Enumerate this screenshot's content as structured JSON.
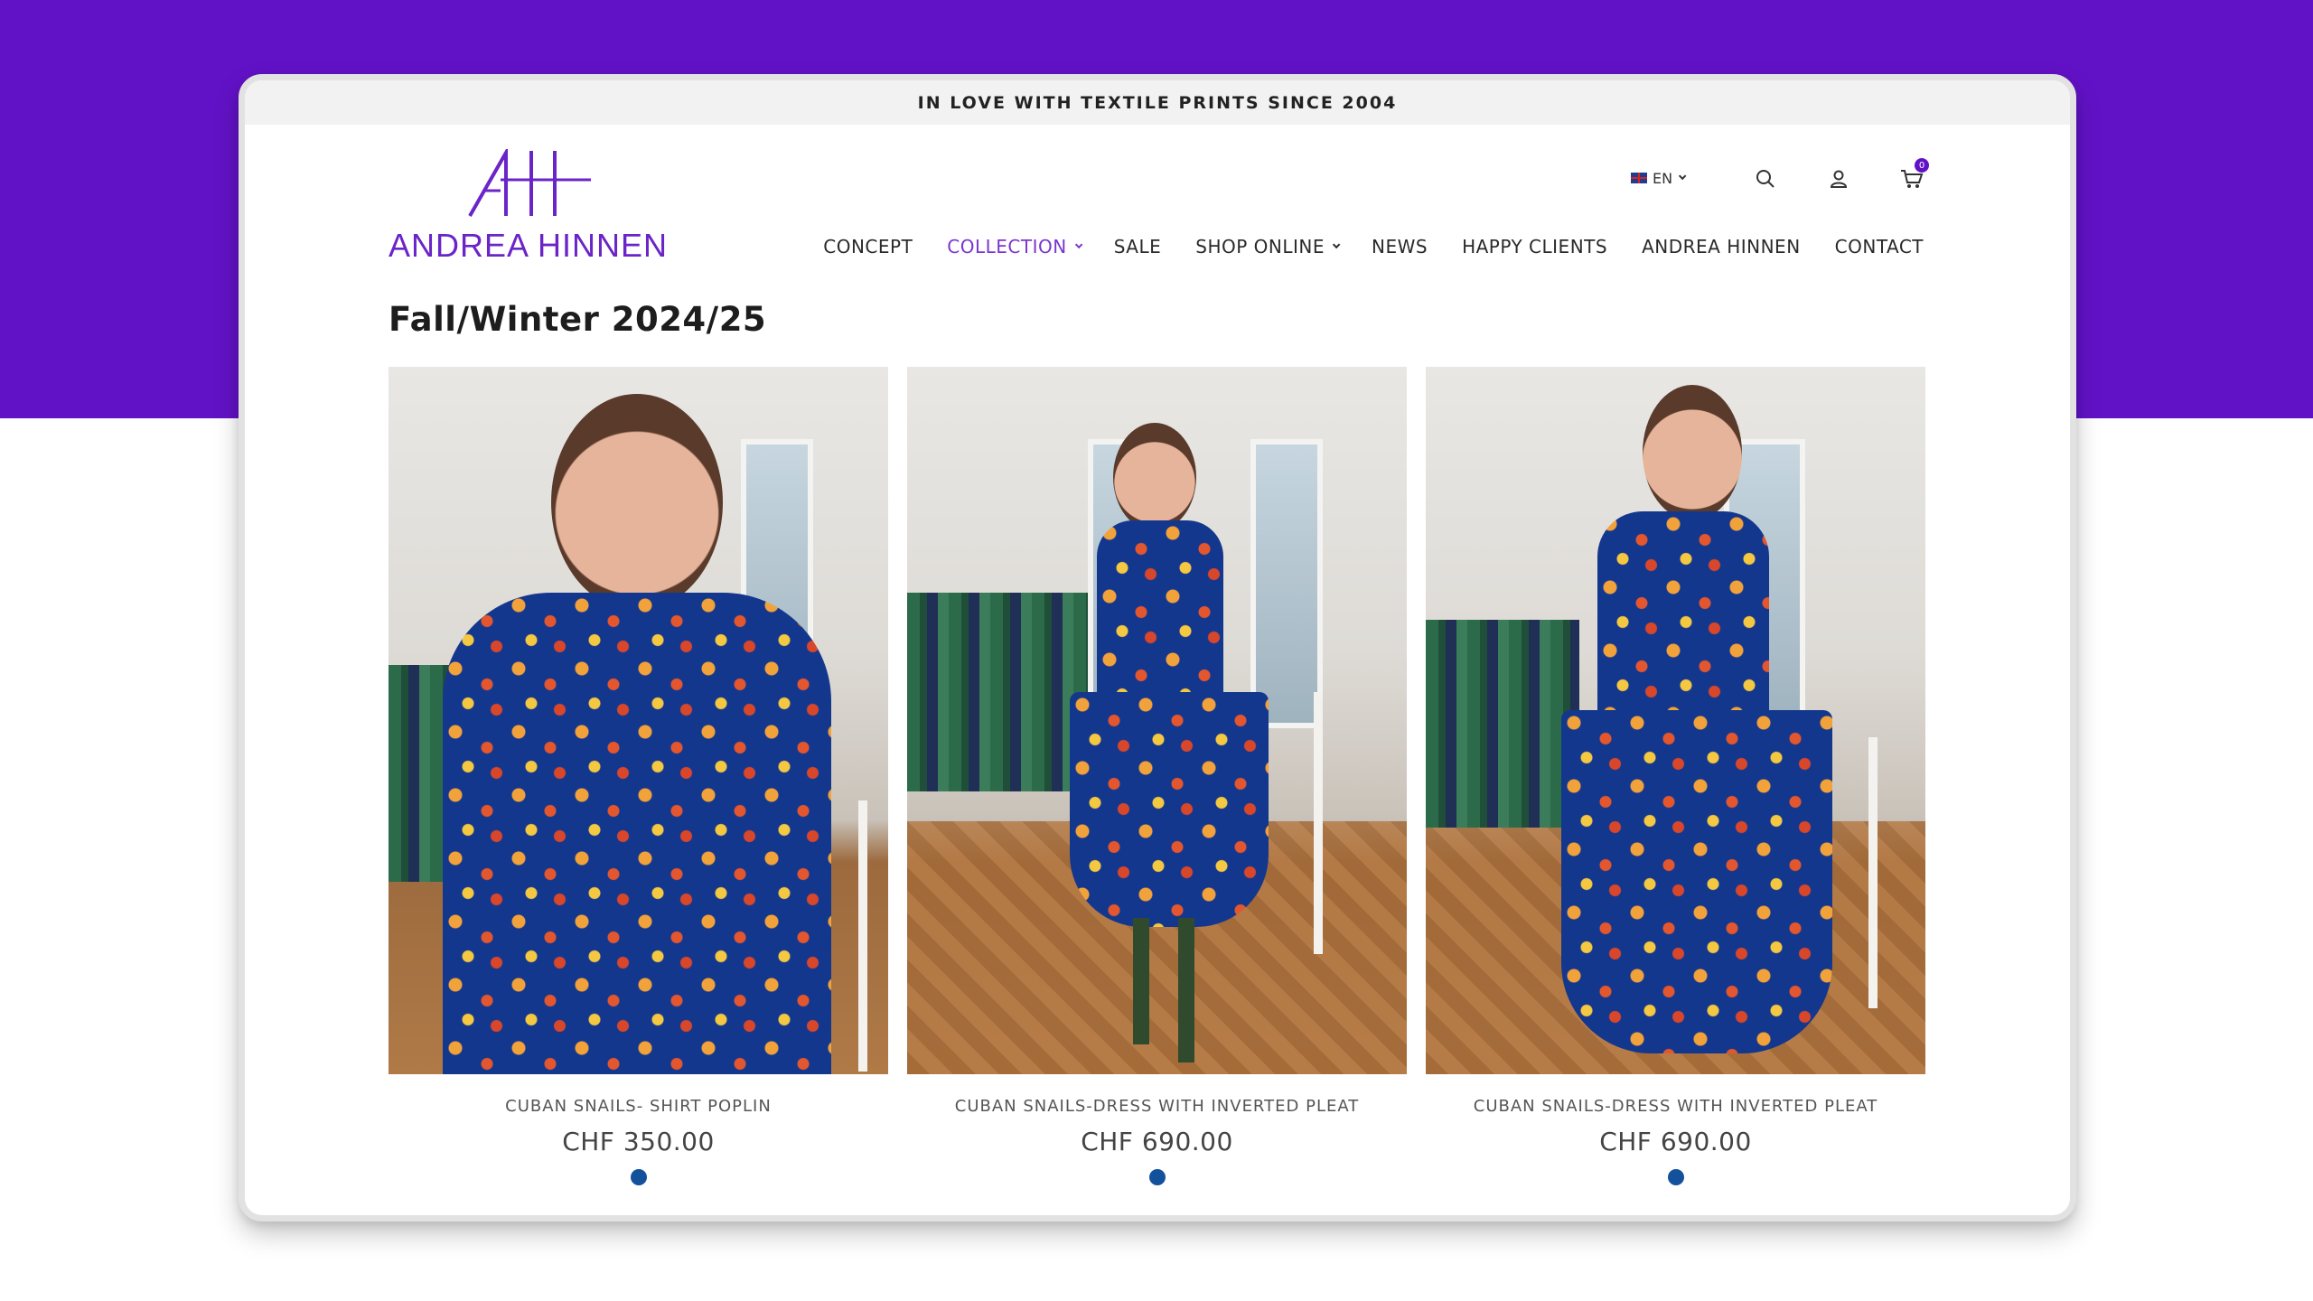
{
  "announcement": "IN LOVE WITH TEXTILE PRINTS SINCE 2004",
  "brand": {
    "name": "ANDREA HINNEN",
    "accent_color": "#6212c6"
  },
  "utility": {
    "language": "EN",
    "cart_count": "0",
    "icons": [
      "uk-flag-icon",
      "search-icon",
      "user-icon",
      "cart-icon"
    ]
  },
  "nav": {
    "items": [
      {
        "label": "CONCEPT",
        "active": false
      },
      {
        "label": "COLLECTION",
        "active": true,
        "dropdown": true
      },
      {
        "label": "SALE",
        "active": false
      },
      {
        "label": "SHOP ONLINE",
        "active": false,
        "dropdown": true
      },
      {
        "label": "NEWS",
        "active": false
      },
      {
        "label": "HAPPY CLIENTS",
        "active": false
      },
      {
        "label": "ANDREA HINNEN",
        "active": false
      },
      {
        "label": "CONTACT",
        "active": false
      }
    ]
  },
  "page_title": "Fall/Winter 2024/25",
  "products": [
    {
      "name": "CUBAN SNAILS- SHIRT POPLIN",
      "price": "CHF 350.00",
      "swatch_color": "#14519c"
    },
    {
      "name": "CUBAN SNAILS-DRESS WITH INVERTED PLEAT",
      "price": "CHF 690.00",
      "swatch_color": "#14519c"
    },
    {
      "name": "CUBAN SNAILS-DRESS WITH INVERTED PLEAT",
      "price": "CHF 690.00",
      "swatch_color": "#14519c"
    }
  ]
}
